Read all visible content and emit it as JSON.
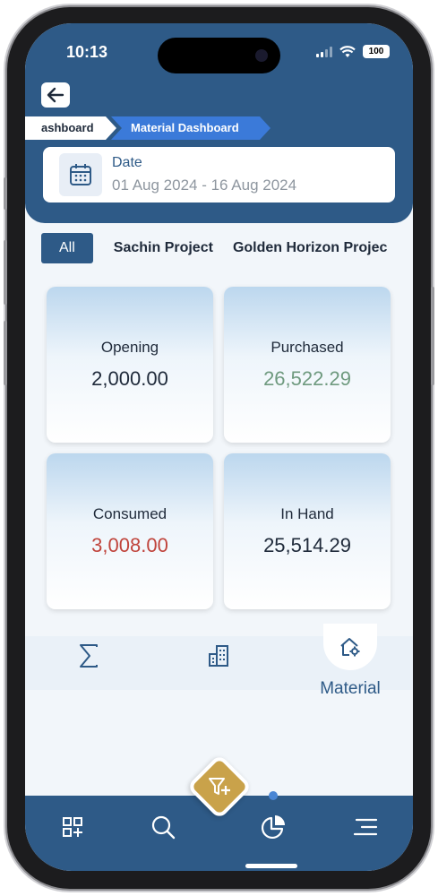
{
  "status": {
    "time": "10:13",
    "battery": "100"
  },
  "breadcrumb": {
    "previous": "ashboard",
    "current": "Material Dashboard"
  },
  "date_filter": {
    "label": "Date",
    "value": "01 Aug 2024 - 16 Aug 2024"
  },
  "tabs": [
    {
      "label": "All",
      "active": true
    },
    {
      "label": "Sachin Project",
      "active": false
    },
    {
      "label": "Golden Horizon Projec",
      "active": false
    }
  ],
  "cards": {
    "opening": {
      "label": "Opening",
      "value": "2,000.00",
      "color": "#1f2a3a"
    },
    "purchased": {
      "label": "Purchased",
      "value": "26,522.29",
      "color": "#6f9a7f"
    },
    "consumed": {
      "label": "Consumed",
      "value": "3,008.00",
      "color": "#c0443c"
    },
    "in_hand": {
      "label": "In Hand",
      "value": "25,514.29",
      "color": "#1f2a3a"
    }
  },
  "subnav": {
    "items": [
      {
        "icon": "sigma-icon"
      },
      {
        "icon": "building-icon"
      },
      {
        "icon": "home-gear-icon",
        "label": "Material"
      }
    ]
  },
  "bottom_nav": {
    "icons": [
      "grid-add-icon",
      "search-icon",
      "pie-chart-icon",
      "menu-icon"
    ],
    "fab_icon": "filter-add-icon"
  },
  "colors": {
    "primary": "#2e5a87",
    "accent": "#3b7ad9",
    "fab": "#c9a24a"
  }
}
